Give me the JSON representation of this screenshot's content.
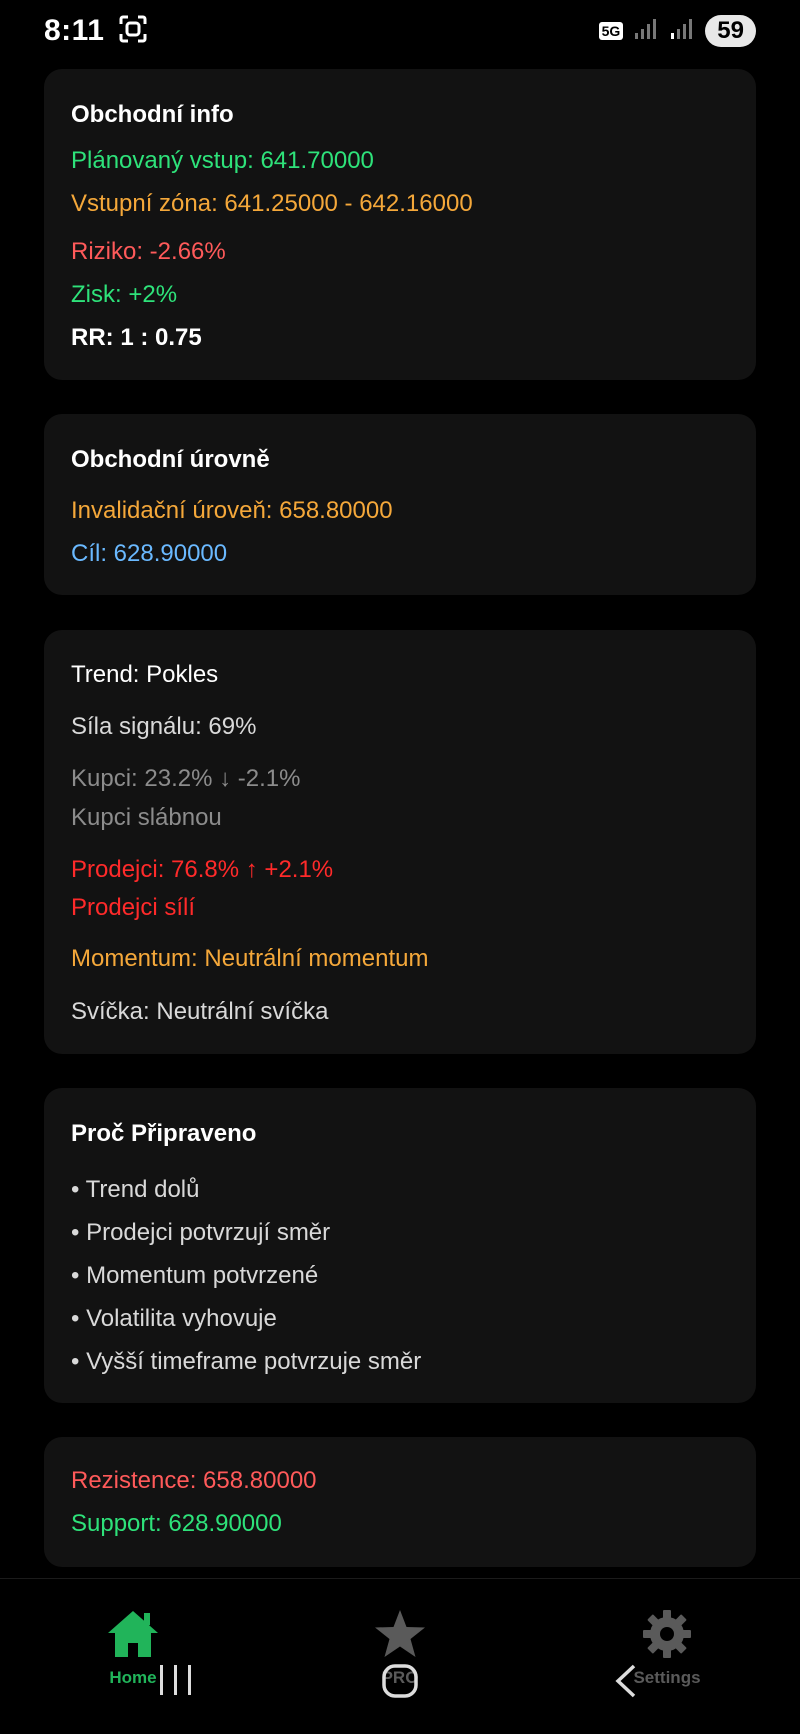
{
  "status": {
    "time": "8:11",
    "network": "5G",
    "battery": "59"
  },
  "cards": {
    "trade_info": {
      "title": "Obchodní info",
      "planned_entry": "Plánovaný vstup: 641.70000",
      "entry_zone": "Vstupní zóna: 641.25000 - 642.16000",
      "risk": "Riziko: -2.66%",
      "profit": "Zisk: +2%",
      "rr": "RR: 1 : 0.75"
    },
    "trade_levels": {
      "title": "Obchodní úrovně",
      "invalidation": "Invalidační úroveň: 658.80000",
      "target": "Cíl: 628.90000"
    },
    "trend": {
      "trend": "Trend: Pokles",
      "signal_strength": "Síla signálu: 69%",
      "buyers": "Kupci: 23.2% ↓ -2.1%",
      "buyers_note": "Kupci slábnou",
      "sellers": "Prodejci: 76.8% ↑ +2.1%",
      "sellers_note": "Prodejci sílí",
      "momentum": "Momentum: Neutrální momentum",
      "candle": "Svíčka: Neutrální svíčka"
    },
    "why_ready": {
      "title": "Proč Připraveno",
      "items": [
        "• Trend dolů",
        "• Prodejci potvrzují směr",
        "• Momentum potvrzené",
        "• Volatilita vyhovuje",
        "• Vyšší timeframe potvrzuje směr"
      ]
    },
    "levels": {
      "resistance": "Rezistence: 658.80000",
      "support": "Support: 628.90000"
    }
  },
  "nav": {
    "home": "Home",
    "pro": "PRO",
    "settings": "Settings"
  },
  "colors": {
    "home_active": "#21b45a",
    "inactive": "#5a5a5a"
  }
}
